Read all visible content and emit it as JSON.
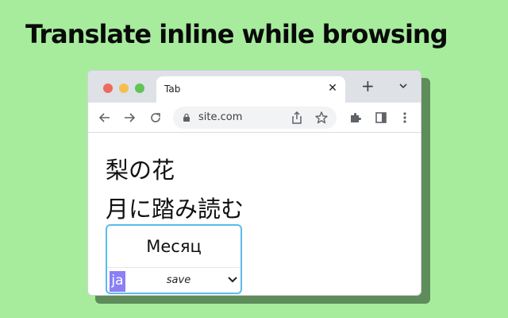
{
  "headline": "Translate inline while browsing",
  "browser": {
    "tab_title": "Tab",
    "tab_close": "✕",
    "new_tab": "+",
    "url": "site.com"
  },
  "page": {
    "line1": "梨の花",
    "line2": "月に踏み読む"
  },
  "popup": {
    "translation": "Месяц",
    "lang": "ja",
    "save_label": "save"
  },
  "colors": {
    "background": "#a6ec9c",
    "popup_border": "#5bbce8",
    "lang_badge": "#8a7ff5"
  },
  "icons": [
    "back-arrow-icon",
    "forward-arrow-icon",
    "reload-icon",
    "lock-icon",
    "share-icon",
    "star-icon",
    "extensions-puzzle-icon",
    "side-panel-icon",
    "kebab-menu-icon",
    "chevron-down-icon"
  ]
}
